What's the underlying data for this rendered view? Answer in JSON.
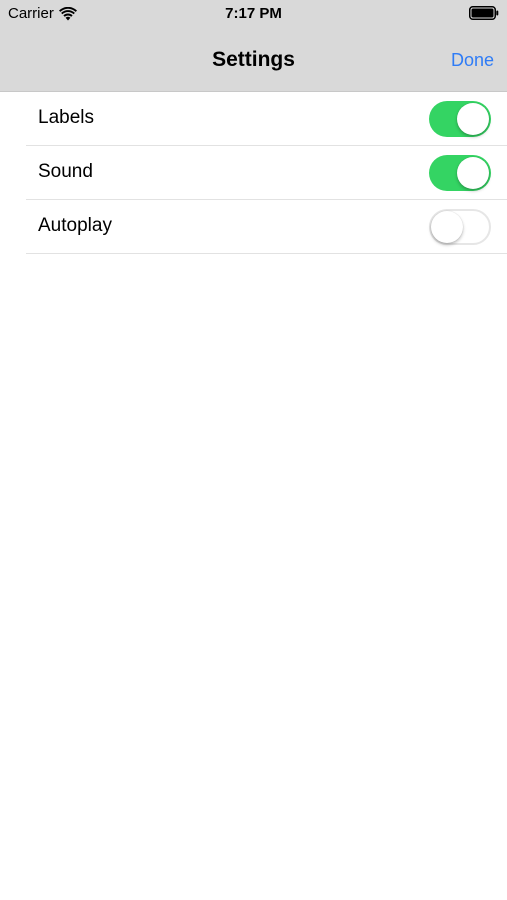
{
  "status_bar": {
    "carrier": "Carrier",
    "time": "7:17 PM",
    "wifi_icon": "wifi-icon",
    "battery_icon": "battery-full-icon"
  },
  "nav_bar": {
    "title": "Settings",
    "done_label": "Done"
  },
  "settings": {
    "items": [
      {
        "label": "Labels",
        "enabled": true
      },
      {
        "label": "Sound",
        "enabled": true
      },
      {
        "label": "Autoplay",
        "enabled": false
      }
    ]
  },
  "colors": {
    "toggle_on": "#34d463",
    "accent": "#2f7cf6",
    "nav_background": "#d9d9d9"
  }
}
